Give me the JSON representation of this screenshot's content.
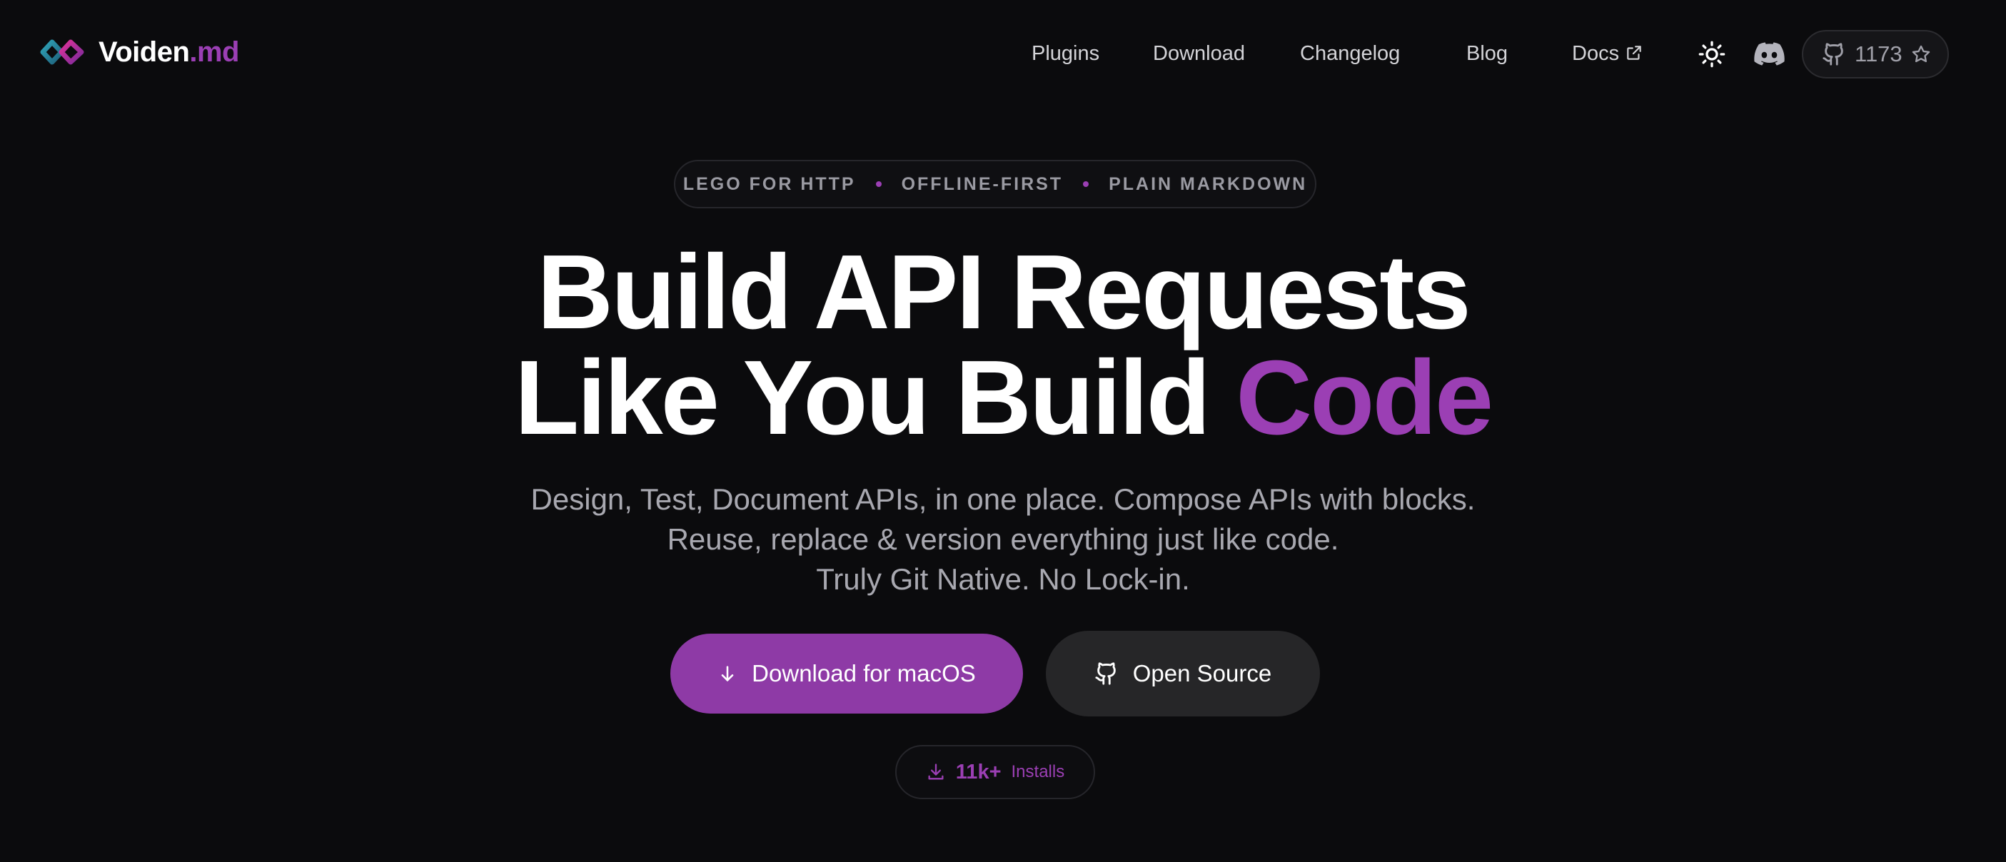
{
  "brand": {
    "name": "Voiden",
    "ext": ".md"
  },
  "nav": {
    "plugins": "Plugins",
    "download": "Download",
    "changelog": "Changelog",
    "blog": "Blog",
    "docs": "Docs"
  },
  "github": {
    "stars": "1173"
  },
  "hero": {
    "badges": [
      "LEGO FOR HTTP",
      "OFFLINE-FIRST",
      "PLAIN MARKDOWN"
    ],
    "headline_line1": "Build API Requests",
    "headline_line2": "Like You Build",
    "headline_accent": "Code",
    "subtitle_lines": [
      "Design, Test, Document APIs, in one place. Compose APIs with blocks.",
      "Reuse, replace & version everything just like code.",
      "Truly Git Native. No Lock-in."
    ],
    "primary_button": "Download for macOS",
    "secondary_button": "Open Source",
    "installs_count": "11k+",
    "installs_label": "Installs"
  },
  "icons": {
    "logo": "voiden-logo-icon",
    "docs_external": "external-link-icon",
    "theme": "sun-icon",
    "discord": "discord-icon",
    "github": "github-icon",
    "star": "star-icon",
    "download_arrow": "arrow-down-icon",
    "installs": "download-tray-icon"
  },
  "colors": {
    "background": "#0b0b0d",
    "accent": "#9b3fb4",
    "primary_button": "#8e3aa6",
    "secondary_button": "#262628"
  }
}
